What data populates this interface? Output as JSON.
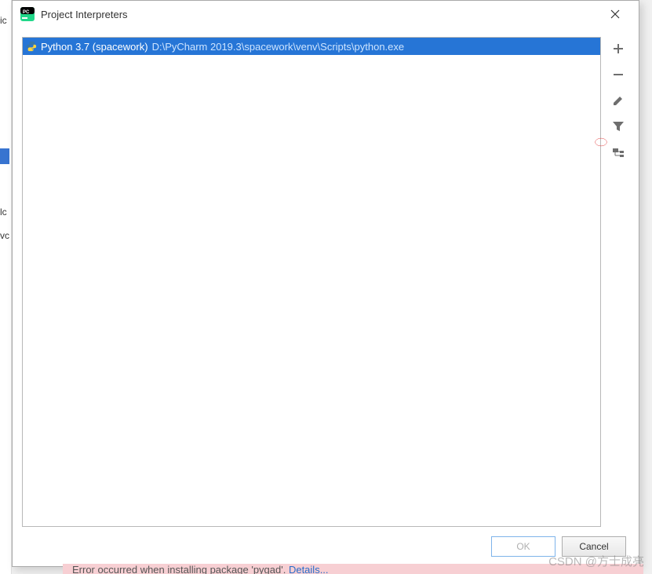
{
  "background": {
    "side_label_1": "ic",
    "side_label_2": "lc",
    "side_label_3": "vc"
  },
  "dialog": {
    "title": "Project Interpreters",
    "interpreters": [
      {
        "name": "Python 3.7 (spacework)",
        "path": "D:\\PyCharm 2019.3\\spacework\\venv\\Scripts\\python.exe"
      }
    ],
    "toolbar": {
      "add": "+",
      "remove": "−",
      "edit": "edit",
      "filter": "filter",
      "paths": "paths"
    },
    "buttons": {
      "ok": "OK",
      "cancel": "Cancel"
    }
  },
  "error": {
    "text": "Error occurred when installing package 'pygad'. ",
    "link": "Details..."
  },
  "watermark": "CSDN @方士成亮"
}
